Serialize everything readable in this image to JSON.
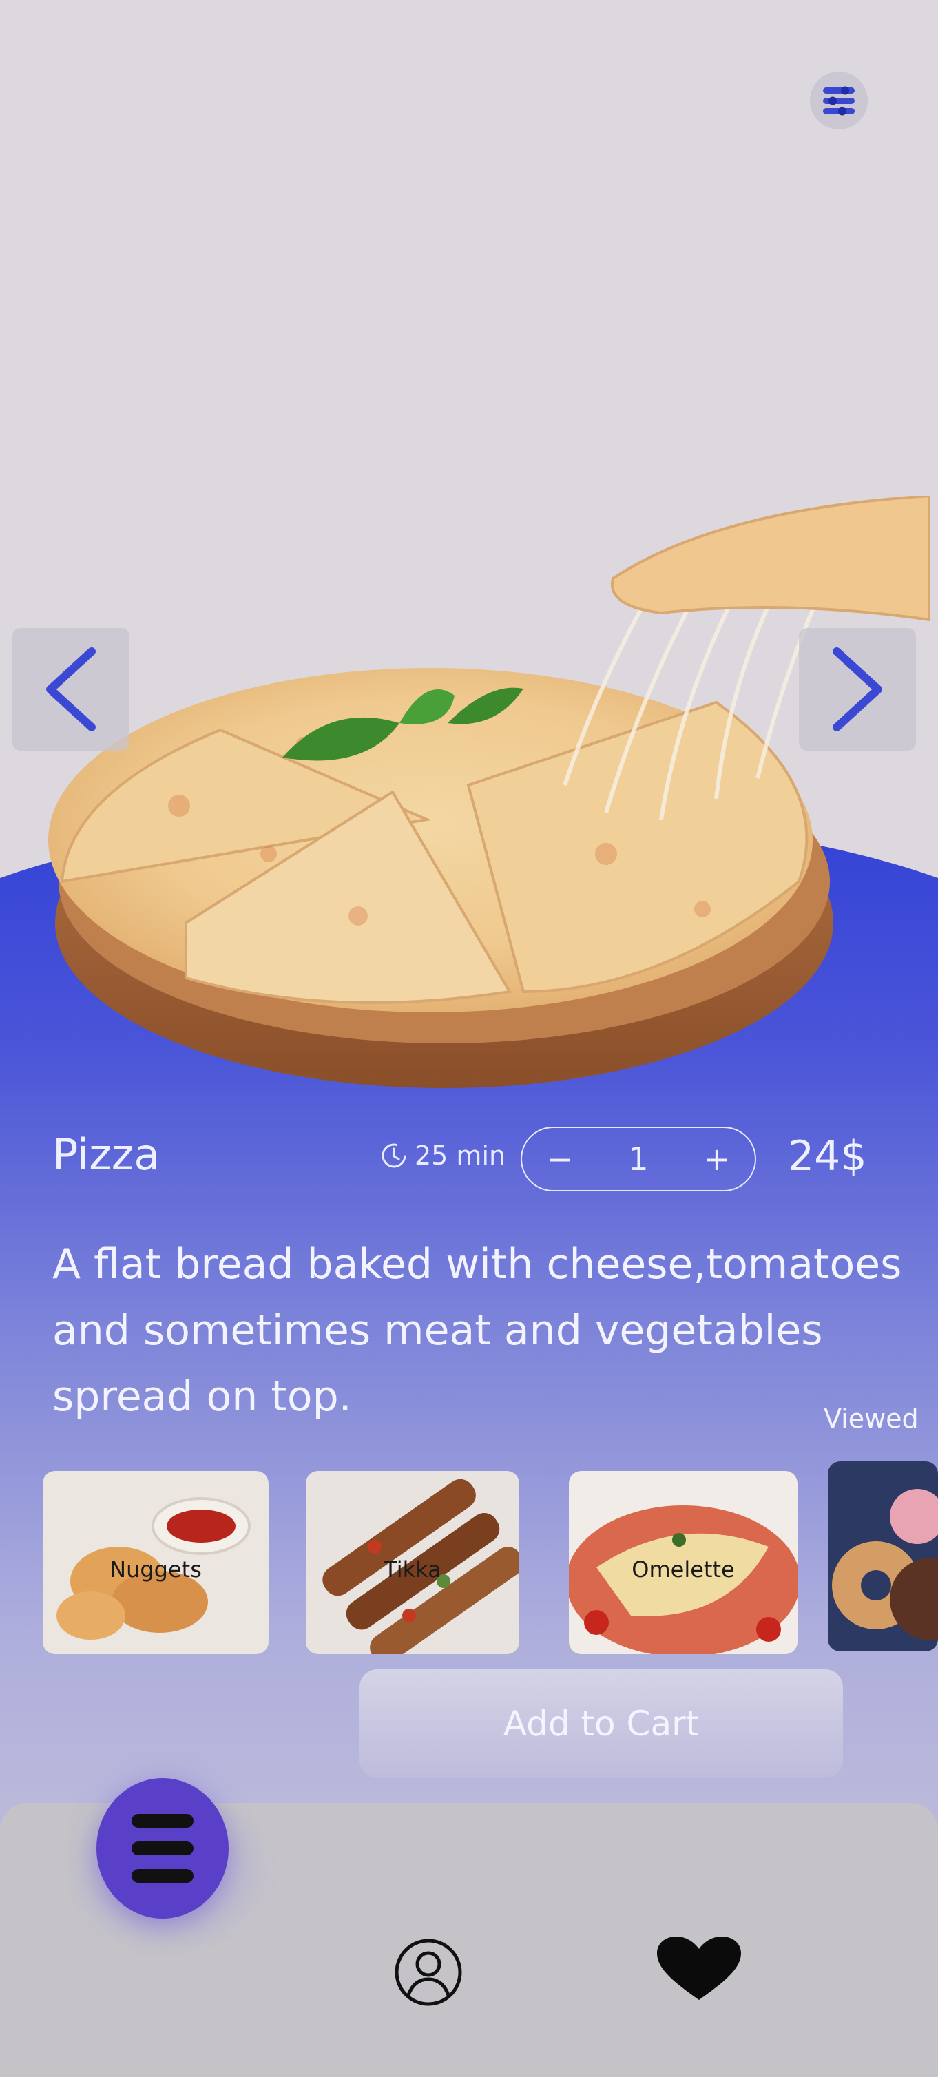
{
  "header": {
    "filter_icon": "sliders-icon"
  },
  "carousel": {
    "prev_icon": "chevron-left-icon",
    "next_icon": "chevron-right-icon"
  },
  "product": {
    "name": "Pizza",
    "time_icon": "clock-icon",
    "time": "25 min",
    "quantity": {
      "minus": "−",
      "value": "1",
      "plus": "+"
    },
    "price": "24$",
    "description": "A flat bread baked with cheese,tomatoes\nand sometimes meat and vegetables\nspread on top."
  },
  "viewed": {
    "label": "Viewed",
    "items": [
      {
        "label": "Nuggets"
      },
      {
        "label": "Tikka"
      },
      {
        "label": "Omelette"
      },
      {
        "label": ""
      }
    ]
  },
  "cart": {
    "label": "Add to Cart"
  },
  "nav": {
    "menu_icon": "menu-icon",
    "profile_icon": "user-circle-icon",
    "favorites_icon": "heart-icon"
  },
  "colors": {
    "accent": "#3342d6",
    "menu_button": "#5a40c8",
    "background": "#dcd8dd"
  }
}
